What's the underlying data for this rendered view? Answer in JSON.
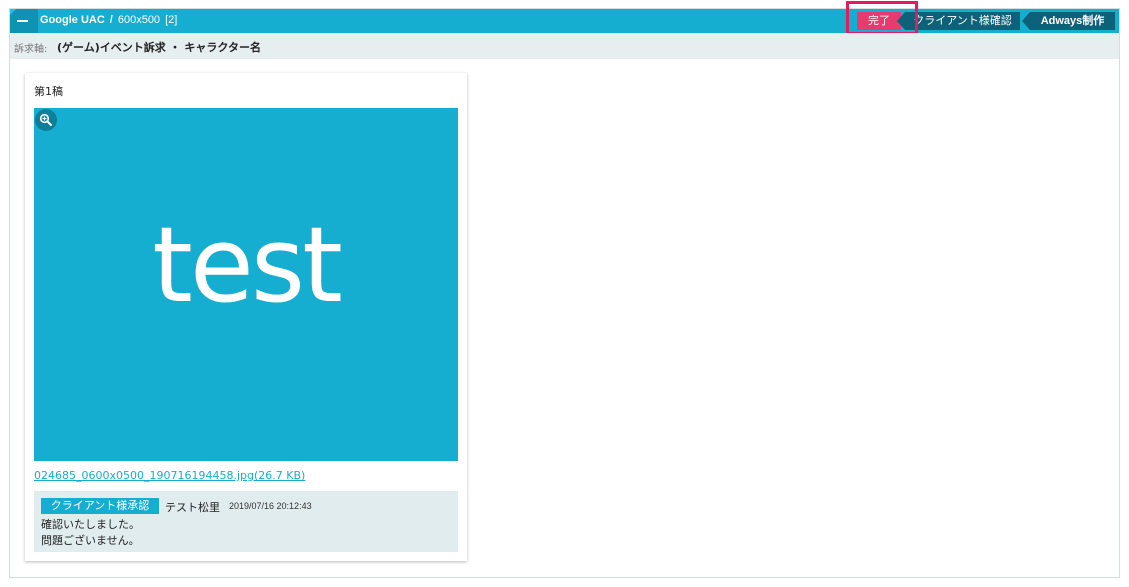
{
  "header": {
    "platform": "Google UAC",
    "separator": "/",
    "size": "600x500",
    "count": "[2]"
  },
  "workflow": {
    "steps": [
      {
        "label": "完了",
        "color": "#e63b6f",
        "active": true
      },
      {
        "label": "クライアント様確認",
        "color": "#0d6179"
      },
      {
        "label": "Adways制作",
        "color": "#0d6179"
      }
    ]
  },
  "appeal_axis": {
    "label": "訴求軸:",
    "value": "(ゲーム)イベント訴求 ・ キャラクター名"
  },
  "draft": {
    "title": "第1稿",
    "image_text": "test",
    "image_bg": "#16aed0",
    "file_link": "024685_0600x0500_190716194458.jpg(26.7 KB)",
    "zoom_icon": "zoom-in-icon"
  },
  "comment": {
    "badge": "クライアント様承認",
    "author": "テスト松里",
    "timestamp": "2019/07/16 20:12:43",
    "lines": [
      "確認いたしました。",
      "問題ございません。"
    ]
  }
}
